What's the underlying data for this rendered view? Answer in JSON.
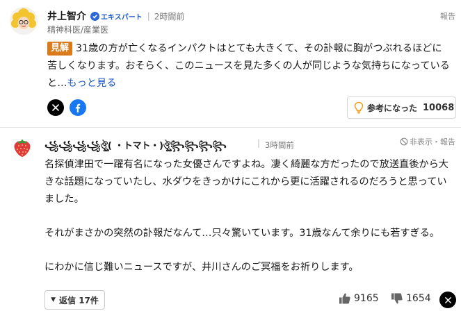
{
  "expert_comment": {
    "name": "井上智介",
    "badge_label": "エキスパート",
    "separator": "|",
    "time": "2時間前",
    "affiliation": "精神科医/産業医",
    "report_label": "報告",
    "kenkai_label": "見解",
    "text": "31歳の方が亡くなるインパクトはとても大きくて、その訃報に胸がつぶれるほどに苦しくなります。おそらく、このニュースを見た多くの人が同じような気持ちになっていると…",
    "more_label": "もっと見る",
    "useful_label": "参考になった",
    "useful_count": "10068",
    "share_icons": [
      "x-icon",
      "facebook-icon"
    ]
  },
  "user_comment": {
    "name": "꧁꧁꧁꧁ঔৣ( ・トマト・)ঔৣ꧂꧂꧂꧂",
    "separator": "|",
    "time": "3時間前",
    "hide_report_label": "非表示・報告",
    "paragraphs": [
      "名探偵津田で一躍有名になった女優さんですよね。凄く綺麗な方だったので放送直後から大きな話題になっていたし、水ダウをきっかけにこれから更に活躍されるのだろうと思っていました。",
      "それがまさかの突然の訃報だなんて…只々驚いています。31歳なんて余りにも若すぎる。",
      "にわかに信じ難いニュースですが、井川さんのご冥福をお祈りします。"
    ],
    "reply_label": "返信 17件",
    "like_count": "9165",
    "dislike_count": "1654"
  },
  "colors": {
    "kenkai_badge": "#d97a1b",
    "link_blue": "#1a58c4",
    "verified_blue": "#2a67d8",
    "facebook_blue": "#1877f2",
    "strawberry_red": "#e03a3a",
    "bulb_orange": "#f0a020"
  }
}
